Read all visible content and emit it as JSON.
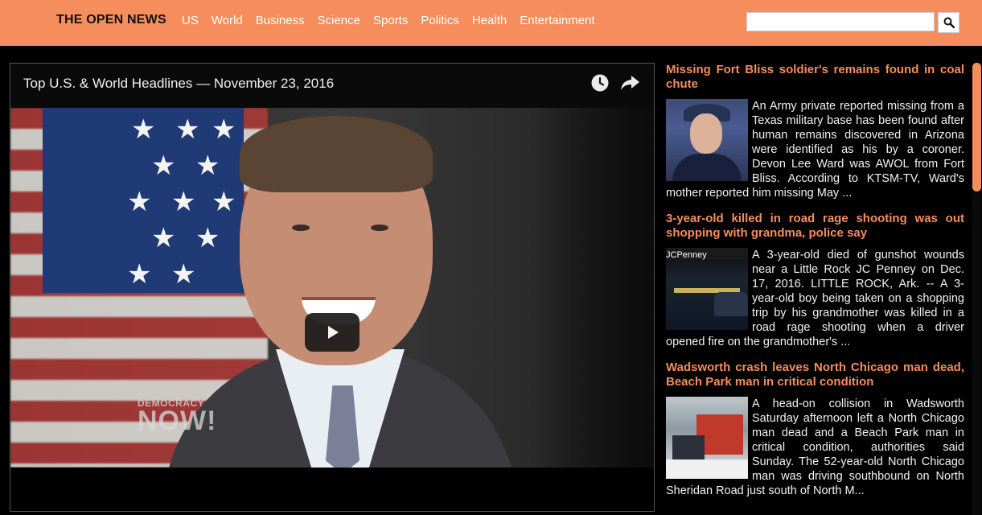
{
  "header": {
    "brand": "THE OPEN NEWS",
    "nav": [
      "US",
      "World",
      "Business",
      "Science",
      "Sports",
      "Politics",
      "Health",
      "Entertainment"
    ],
    "search": {
      "value": "",
      "placeholder": "",
      "button_icon": "search-icon"
    }
  },
  "video": {
    "title": "Top U.S. & World Headlines — November 23, 2016",
    "watermark_top": "DEMOCRACY",
    "watermark_bottom": "NOW!",
    "controls": [
      "clock-icon",
      "share-icon"
    ],
    "play_icon": "play-icon"
  },
  "articles": [
    {
      "headline": "Missing Fort Bliss soldier's remains found in coal chute",
      "blurb": "An Army private reported missing from a Texas military base has been found after human remains discovered in Arizona were identified as his by a coroner. Devon Lee Ward was AWOL from Fort Bliss. According to KTSM-TV, Ward's mother reported him missing May ..."
    },
    {
      "headline": "3-year-old killed in road rage shooting was out shopping with grandma, police say",
      "blurb": "A 3-year-old died of gunshot wounds near a Little Rock JC Penney on Dec. 17, 2016. LITTLE ROCK, Ark. -- A 3-year-old boy being taken on a shopping trip by his grandmother was killed in a road rage shooting when a driver opened fire on the grandmother's ..."
    },
    {
      "headline": "Wadsworth crash leaves North Chicago man dead, Beach Park man in critical condition",
      "blurb": "A head-on collision in Wadsworth Saturday afternoon left a North Chicago man dead and a Beach Park man in critical condition, authorities said Sunday. The 52-year-old North Chicago man was driving southbound on North Sheridan Road just south of North M..."
    }
  ],
  "thumb2_sign": "JCPenney",
  "colors": {
    "header_bg": "#f58d5c",
    "accent": "#f58d5c",
    "page_bg": "#000000"
  }
}
